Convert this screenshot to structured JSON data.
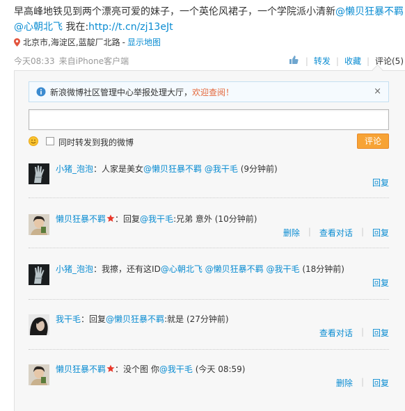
{
  "post": {
    "text": "早高峰地铁见到两个漂亮可爱的妹子，一个英伦风裙子，一个学院派小清新",
    "mention1": "@懒贝狂暴不羁",
    "mention2": "@心朝北飞",
    "mid_text": " 我在:",
    "link": "http://t.cn/zj13eJt",
    "location": "北京市,海淀区,蓝靛厂北路",
    "location_sep": "-",
    "map_link": "显示地图"
  },
  "meta": {
    "time": "今天08:33",
    "source_prefix": "来自",
    "source": "iPhone客户端"
  },
  "actions": {
    "forward": "转发",
    "favorite": "收藏",
    "comment": "评论(5)",
    "sep": "|"
  },
  "notice": {
    "text": "新浪微博社区管理中心举报处理大厅，",
    "link": "欢迎查阅！",
    "close": "×"
  },
  "composer": {
    "placeholder": "",
    "checkbox_label": "同时转发到我的微博",
    "submit": "评论"
  },
  "comments": [
    {
      "user": "小猪_泡泡",
      "colon": "：",
      "text": "人家是美女",
      "mentions": [
        "@懒贝狂暴不羁",
        "@我干毛"
      ],
      "time": "(9分钟前)",
      "actions": [
        "回复"
      ]
    },
    {
      "user": "懒贝狂暴不羁",
      "colon": "：",
      "reply_prefix": "回复",
      "mentions": [
        "@我干毛"
      ],
      "text": ":兄弟 意外",
      "time": "(10分钟前)",
      "actions": [
        "删除",
        "查看对话",
        "回复"
      ]
    },
    {
      "user": "小猪_泡泡",
      "colon": "：",
      "text": "我擦，还有这ID",
      "mentions": [
        "@心朝北飞",
        "@懒贝狂暴不羁",
        "@我干毛"
      ],
      "time": "(18分钟前)",
      "actions": [
        "回复"
      ]
    },
    {
      "user": "我干毛",
      "colon": "：",
      "reply_prefix": "回复",
      "mentions": [
        "@懒贝狂暴不羁"
      ],
      "text": ":就是",
      "time": "(27分钟前)",
      "actions": [
        "查看对话",
        "回复"
      ]
    },
    {
      "user": "懒贝狂暴不羁",
      "colon": "：",
      "text": "没个图 你",
      "mentions": [
        "@我干毛"
      ],
      "time": "(今天 08:59)",
      "actions": [
        "删除",
        "回复"
      ]
    }
  ],
  "colors": {
    "link": "#0a8cd2",
    "submit_bg": "#f7a335",
    "notice_link": "#e4683c"
  }
}
